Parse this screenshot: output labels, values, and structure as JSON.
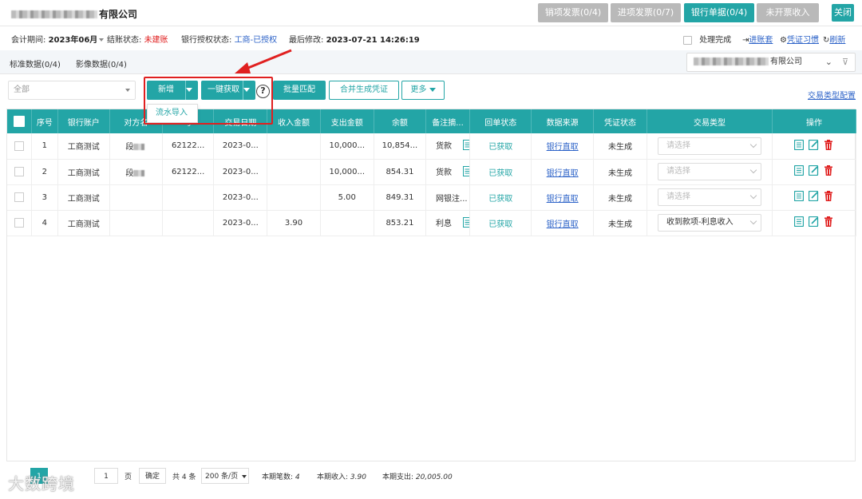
{
  "header": {
    "company_suffix": "有限公司",
    "tabs": [
      {
        "label": "销项发票(0/4)",
        "active": false
      },
      {
        "label": "进项发票(0/7)",
        "active": false
      },
      {
        "label": "银行单据(0/4)",
        "active": true
      },
      {
        "label": "未开票收入",
        "active": false
      }
    ],
    "close_label": "关闭"
  },
  "info": {
    "period_label": "会计期间:",
    "period_value": "2023年06月",
    "close_status_label": "结账状态:",
    "close_status_value": "未建账",
    "bank_auth_label": "银行授权状态:",
    "bank_auth_value": "工商-已授权",
    "last_modified_label": "最后修改:",
    "last_modified_value": "2023-07-21 14:26:19",
    "processed_label": "处理完成",
    "enter_books_label": "进账套",
    "voucher_habit_label": "凭证习惯",
    "refresh_label": "刷新"
  },
  "subtabs": {
    "standard": "标准数据(0/4)",
    "image": "影像数据(0/4)",
    "company_select_suffix": "有限公司"
  },
  "toolbar": {
    "filter_value": "全部",
    "add_label": "新增",
    "fetch_label": "一键获取",
    "help_symbol": "?",
    "batch_match_label": "批量匹配",
    "merge_voucher_label": "合并生成凭证",
    "more_label": "更多",
    "type_config_label": "交易类型配置",
    "dropdown_item": "流水导入"
  },
  "table": {
    "columns": [
      "序号",
      "银行账户",
      "对方名称",
      "对方账号",
      "交易日期",
      "收入金额",
      "支出金额",
      "余额",
      "备注摘...",
      "回单状态",
      "数据来源",
      "凭证状态",
      "交易类型",
      "操作"
    ],
    "visible_column_headers": [
      "序号",
      "银行账户",
      "对方名",
      "号",
      "交易日期",
      "收入金额",
      "支出金额",
      "余额",
      "备注摘...",
      "回单状态",
      "数据来源",
      "凭证状态",
      "交易类型",
      "操作"
    ],
    "rows": [
      {
        "no": "1",
        "account": "工商测试",
        "counterparty": "段",
        "cp_account": "62122...",
        "date": "2023-0...",
        "income": "",
        "expense": "10,000...",
        "balance": "10,854...",
        "memo": "货款",
        "receipt": "已获取",
        "source": "银行直取",
        "voucher": "未生成",
        "type": "请选择",
        "type_filled": false
      },
      {
        "no": "2",
        "account": "工商测试",
        "counterparty": "段",
        "cp_account": "62122...",
        "date": "2023-0...",
        "income": "",
        "expense": "10,000...",
        "balance": "854.31",
        "memo": "货款",
        "receipt": "已获取",
        "source": "银行直取",
        "voucher": "未生成",
        "type": "请选择",
        "type_filled": false
      },
      {
        "no": "3",
        "account": "工商测试",
        "counterparty": "",
        "cp_account": "",
        "date": "2023-0...",
        "income": "",
        "expense": "5.00",
        "balance": "849.31",
        "memo": "网银注...",
        "receipt": "已获取",
        "source": "银行直取",
        "voucher": "未生成",
        "type": "请选择",
        "type_filled": false
      },
      {
        "no": "4",
        "account": "工商测试",
        "counterparty": "",
        "cp_account": "",
        "date": "2023-0...",
        "income": "3.90",
        "expense": "",
        "balance": "853.21",
        "memo": "利息",
        "receipt": "已获取",
        "source": "银行直取",
        "voucher": "未生成",
        "type": "收到款项-利息收入",
        "type_filled": true
      }
    ]
  },
  "footer": {
    "current_page": "1",
    "page_input": "1",
    "page_word": "页",
    "confirm_label": "确定",
    "total_label": "共 4 条",
    "page_size": "200 条/页",
    "count_label": "本期笔数:",
    "count_value": "4",
    "income_label": "本期收入:",
    "income_value": "3.90",
    "expense_label": "本期支出:",
    "expense_value": "20,005.00"
  },
  "watermark": "大数跨境",
  "colors": {
    "accent": "#23a5a6",
    "alert": "#e02020",
    "link": "#2d63c8",
    "disabled": "#b9b9b9"
  }
}
